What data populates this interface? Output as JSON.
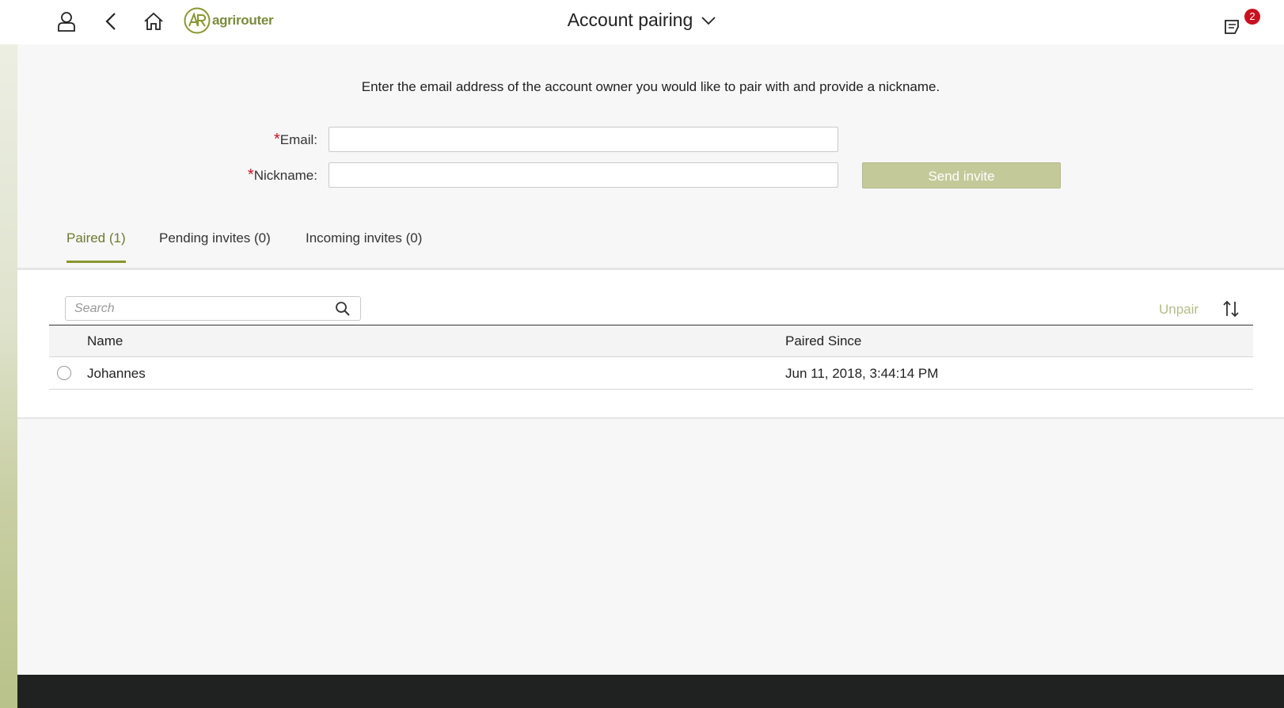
{
  "header": {
    "title": "Account pairing",
    "logo_text": "agrirouter",
    "notification_count": "2",
    "icons": [
      "user-icon",
      "back-arrow-icon",
      "home-icon",
      "agrirouter-logo",
      "chevron-down-icon",
      "notes-icon"
    ]
  },
  "form": {
    "instruction": "Enter the email address of the account owner you would like to pair with and provide a nickname.",
    "required_marker": "*",
    "email_label": "Email:",
    "email_value": "",
    "nickname_label": "Nickname:",
    "nickname_value": "",
    "send_button": "Send invite"
  },
  "tabs": [
    {
      "label": "Paired (1)",
      "active": true
    },
    {
      "label": "Pending invites (0)",
      "active": false
    },
    {
      "label": "Incoming invites (0)",
      "active": false
    }
  ],
  "toolbar": {
    "search_placeholder": "Search",
    "unpair_label": "Unpair"
  },
  "table": {
    "columns": [
      "Name",
      "Paired Since"
    ],
    "rows": [
      {
        "name": "Johannes",
        "paired_since": "Jun 11, 2018, 3:44:14 PM",
        "selected": false
      }
    ]
  },
  "colors": {
    "accent": "#8a962f",
    "button_disabled": "#c4c99a",
    "badge": "#c8101e",
    "footer": "#202221"
  }
}
